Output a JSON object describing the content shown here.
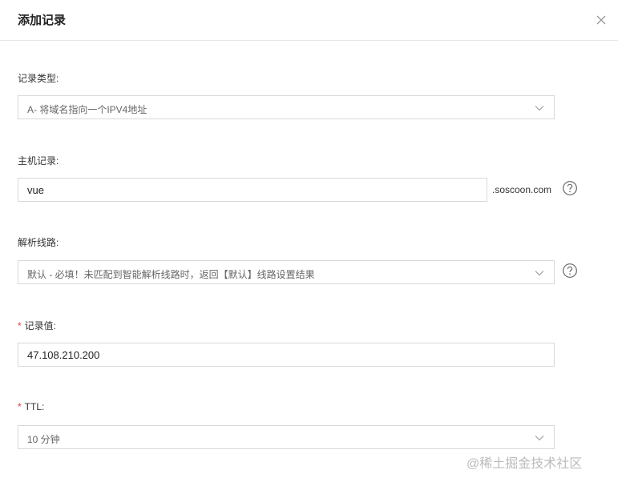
{
  "dialog": {
    "title": "添加记录"
  },
  "record_type": {
    "label": "记录类型:",
    "value": "A- 将域名指向一个IPV4地址"
  },
  "host_record": {
    "label": "主机记录:",
    "value": "vue",
    "suffix": ".soscoon.com"
  },
  "line": {
    "label": "解析线路:",
    "value": "默认 - 必填！未匹配到智能解析线路时，返回【默认】线路设置结果"
  },
  "record_value": {
    "required_mark": "*",
    "label": "记录值:",
    "value": "47.108.210.200"
  },
  "ttl": {
    "required_mark": "*",
    "label": "TTL:",
    "value": "10 分钟"
  },
  "watermark": "@稀土掘金技术社区",
  "icons": {
    "close": "close-icon",
    "chevron": "chevron-down-icon",
    "help": "question-circle-icon"
  },
  "colors": {
    "required": "#e0383e",
    "border": "#d9d9d9",
    "divider": "#e8e8e8"
  }
}
